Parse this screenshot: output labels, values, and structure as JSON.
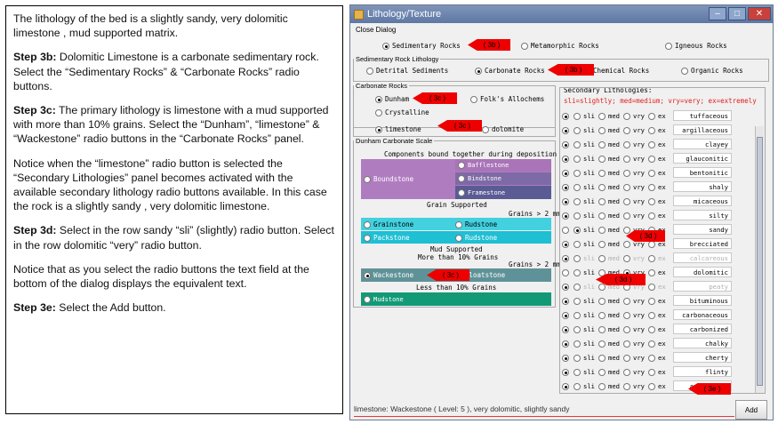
{
  "instructions": {
    "p1": "The lithology of the bed is a  slightly sandy, very dolomitic limestone , mud supported matrix.",
    "p2_step": "Step 3b:",
    "p2": " Dolomitic Limestone is a carbonate sedimentary rock. Select the “Sedimentary Rocks” & “Carbonate Rocks” radio buttons.",
    "p3_step": "Step 3c:",
    "p3": " The primary lithology is limestone with a mud supported with more than 10% grains.  Select the “Dunham”, “limestone” & “Wackestone” radio buttons in the “Carbonate Rocks” panel.",
    "p4": "Notice when the “limestone” radio button is selected the “Secondary Lithologies” panel becomes activated with the available secondary lithology radio buttons available.  In this case the rock is a slightly sandy , very dolomitic limestone.",
    "p5_step": "Step 3d:",
    "p5": " Select in the row sandy “sli” (slightly) radio button.  Select in the row dolomitic “very” radio button.",
    "p6": "Notice that as you select the radio buttons the text field at the bottom of the dialog displays the equivalent text.",
    "p7_step": "Step 3e:",
    "p7": " Select the Add button."
  },
  "window": {
    "title": "Lithology/Texture",
    "menu": "Close Dialog"
  },
  "rock_types": {
    "sedimentary": "Sedimentary Rocks",
    "metamorphic": "Metamorphic Rocks",
    "igneous": "Igneous Rocks"
  },
  "sed_litho": {
    "legend": "Sedimentary Rock Lithology",
    "detrital": "Detrital Sediments",
    "carbonate": "Carbonate Rocks",
    "chemical": "Chemical Rocks",
    "organic": "Organic Rocks"
  },
  "carb": {
    "legend": "Carbonate Rocks",
    "dunham": "Dunham",
    "folk": "Folk's Allochems",
    "crystalline": "Crystalline",
    "limestone": "limestone",
    "dolomite": "dolomite"
  },
  "dunham_scale": {
    "legend": "Dunham Carbonate Scale",
    "components": "Components bound together during deposition",
    "baffle": "Bafflestone",
    "boundstone": "Boundstone",
    "bind": "Bindstone",
    "frame": "Framestone",
    "grain_supported": "Grain Supported",
    "grains_gt2": "Grains > 2 mm",
    "grainstone": "Grainstone",
    "rudstone1": "Rudstone",
    "packstone": "Packstone",
    "rudstone2": "Rudstone",
    "mud_supported": "Mud Supported",
    "more10": "More than 10% Grains",
    "grains_gt2b": "Grains > 2 mm",
    "wackestone": "Wackestone",
    "floatstone": "Floatstone",
    "less10": "Less than 10% Grains",
    "mudstone": "Mudstone"
  },
  "secondary": {
    "legend": "Secondary Lithologies:",
    "key": "sli=slightly; med=medium; vry=very; ex=extremely",
    "opts": [
      "sli",
      "med",
      "vry",
      "ex"
    ],
    "rows": [
      {
        "name": "tuffaceous"
      },
      {
        "name": "argillaceous"
      },
      {
        "name": "clayey"
      },
      {
        "name": "glauconitic"
      },
      {
        "name": "bentonitic"
      },
      {
        "name": "shaly"
      },
      {
        "name": "micaceous"
      },
      {
        "name": "silty"
      },
      {
        "name": "sandy"
      },
      {
        "name": "brecciated"
      },
      {
        "name": "calcareous"
      },
      {
        "name": "dolomitic"
      },
      {
        "name": "peaty"
      },
      {
        "name": "bituminous"
      },
      {
        "name": "carbonaceous"
      },
      {
        "name": "carbonized"
      },
      {
        "name": "chalky"
      },
      {
        "name": "cherty"
      },
      {
        "name": "flinty"
      },
      {
        "name": "anhydritic"
      }
    ]
  },
  "output_text": "limestone: Wackestone ( Level: 5 ), very dolomitic, slightly sandy",
  "add_label": "Add",
  "callouts": {
    "3b": "( 3b )",
    "3c": "( 3c )",
    "3d": "( 3d )",
    "3e": "( 3e )"
  },
  "colors": {
    "boundstone": "#b07cc0",
    "grain": "#43d1e0",
    "packstone": "#1fbfd4",
    "wackestone": "#5f9298",
    "mudstone": "#129a77"
  }
}
